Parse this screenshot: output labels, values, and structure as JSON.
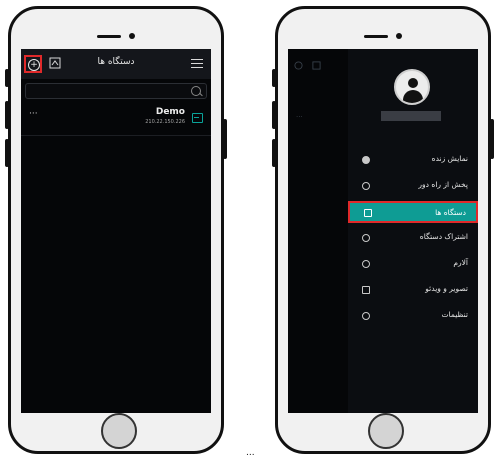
{
  "left_phone": {
    "header": {
      "title": "دستگاه ها"
    },
    "search": {
      "placeholder": ""
    },
    "device": {
      "name": "Demo",
      "ip": "210.22.150.226",
      "more": "···"
    }
  },
  "right_phone": {
    "menu": [
      {
        "label": "نمایش زنده",
        "icon": "dot-icon"
      },
      {
        "label": "پخش از راه دور",
        "icon": "play-circle-icon"
      },
      {
        "label": "دستگاه ها",
        "icon": "device-icon",
        "active": true
      },
      {
        "label": "اشتراک دستگاه",
        "icon": "share-icon"
      },
      {
        "label": "آلارم",
        "icon": "alarm-icon"
      },
      {
        "label": "تصویر و ویدئو",
        "icon": "folder-icon"
      },
      {
        "label": "تنظیمات",
        "icon": "gear-icon"
      }
    ]
  },
  "footer": {
    "ellipsis": "..."
  },
  "colors": {
    "accent": "#0e9c94",
    "highlight": "#e0292a",
    "screen": "#050608"
  }
}
